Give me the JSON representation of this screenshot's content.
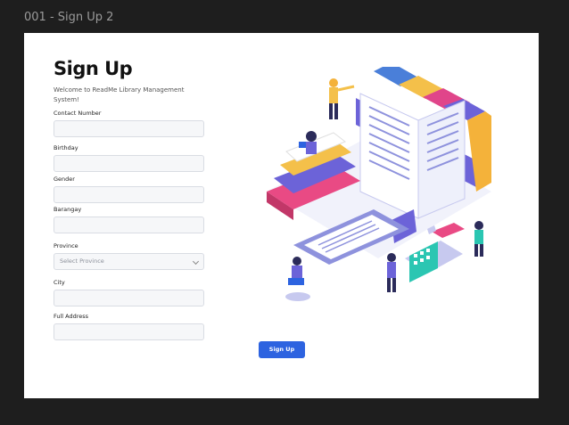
{
  "frame": {
    "label": "001 - Sign Up 2"
  },
  "form": {
    "title": "Sign Up",
    "subtitle": "Welcome to ReadMe Library Management System!",
    "fields": {
      "contact_number": {
        "label": "Contact Number",
        "value": ""
      },
      "birthday": {
        "label": "Birthday",
        "value": ""
      },
      "gender": {
        "label": "Gender",
        "value": ""
      },
      "barangay": {
        "label": "Barangay",
        "value": ""
      },
      "province": {
        "label": "Province",
        "selected": "Select Province"
      },
      "city": {
        "label": "City",
        "value": ""
      },
      "full_address": {
        "label": "Full Address",
        "value": ""
      }
    },
    "submit_label": "Sign Up"
  },
  "colors": {
    "accent": "#2d63e0",
    "background": "#1e1e1e",
    "artboard": "#ffffff"
  },
  "illustration": {
    "subject": "isometric library books and readers"
  }
}
